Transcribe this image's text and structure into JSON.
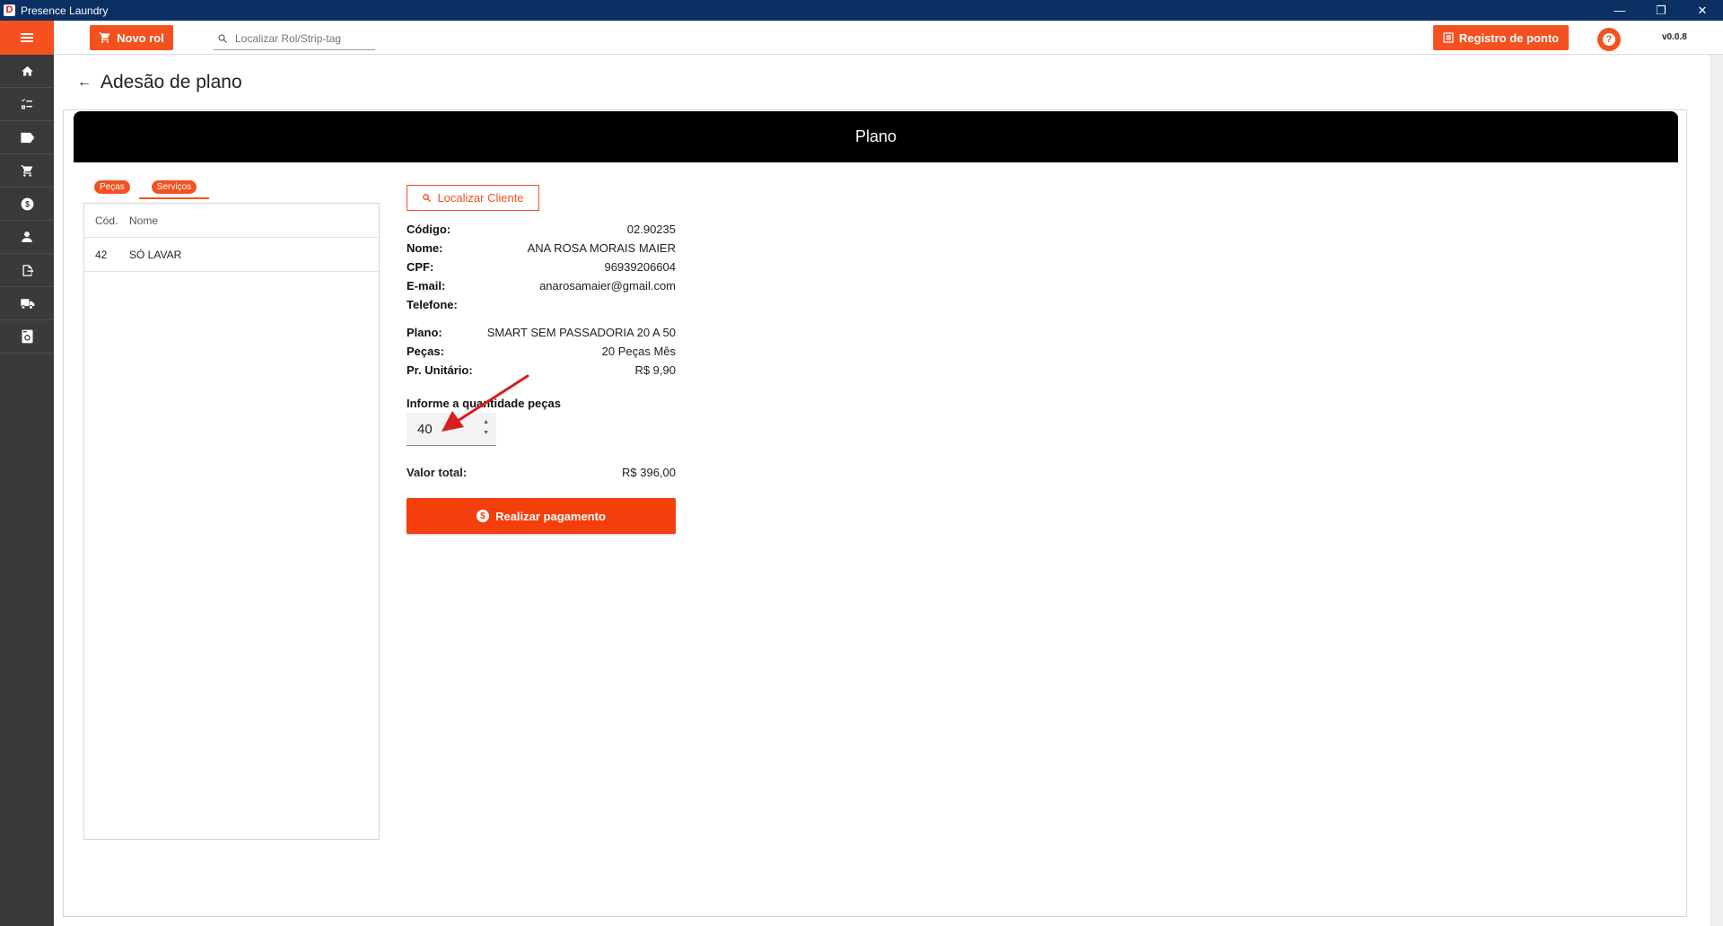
{
  "window": {
    "logo_letter": "D",
    "title": "Presence Laundry",
    "controls": {
      "minimize": "—",
      "restore": "❐",
      "close": "✕"
    }
  },
  "toolbar": {
    "novo_rol_label": "Novo rol",
    "search_placeholder": "Localizar Rol/Strip-tag",
    "registro_label": "Registro de ponto",
    "help_label": "?",
    "version": "v0.0.8"
  },
  "sidebar": {
    "items": [
      {
        "name": "home-icon"
      },
      {
        "name": "checklist-icon"
      },
      {
        "name": "tag-icon"
      },
      {
        "name": "cart-icon"
      },
      {
        "name": "dollar-icon"
      },
      {
        "name": "person-icon"
      },
      {
        "name": "export-icon"
      },
      {
        "name": "delivery-truck-icon"
      },
      {
        "name": "washer-icon"
      }
    ]
  },
  "page": {
    "back_icon": "←",
    "title": "Adesão de plano"
  },
  "card": {
    "header": "Plano"
  },
  "tabs": [
    {
      "label": "Peças",
      "active": false
    },
    {
      "label": "Serviços",
      "active": true
    }
  ],
  "table": {
    "columns": [
      "Cód.",
      "Nome"
    ],
    "rows": [
      {
        "cod": "42",
        "nome": "SÓ LAVAR"
      }
    ]
  },
  "client": {
    "locate_label": "Localizar Cliente",
    "fields": [
      {
        "label": "Código:",
        "value": "02.90235"
      },
      {
        "label": "Nome:",
        "value": "ANA ROSA MORAIS MAIER"
      },
      {
        "label": "CPF:",
        "value": "96939206604"
      },
      {
        "label": "E-mail:",
        "value": "anarosamaier@gmail.com"
      },
      {
        "label": "Telefone:",
        "value": ""
      }
    ],
    "plan_fields": [
      {
        "label": "Plano:",
        "value": "SMART SEM PASSADORIA 20 A 50"
      },
      {
        "label": "Peças:",
        "value": "20 Peças Mês"
      },
      {
        "label": "Pr. Unitário:",
        "value": "R$ 9,90"
      }
    ],
    "quantity_label": "Informe a quantidade peças",
    "quantity_value": "40",
    "total_label": "Valor total:",
    "total_value": "R$ 396,00",
    "pay_label": "Realizar pagamento"
  },
  "colors": {
    "accent": "#f4511e",
    "titlebar": "#0a2f63",
    "sidebar": "#3a3a3a",
    "annotation_arrow": "#d71e1e"
  }
}
